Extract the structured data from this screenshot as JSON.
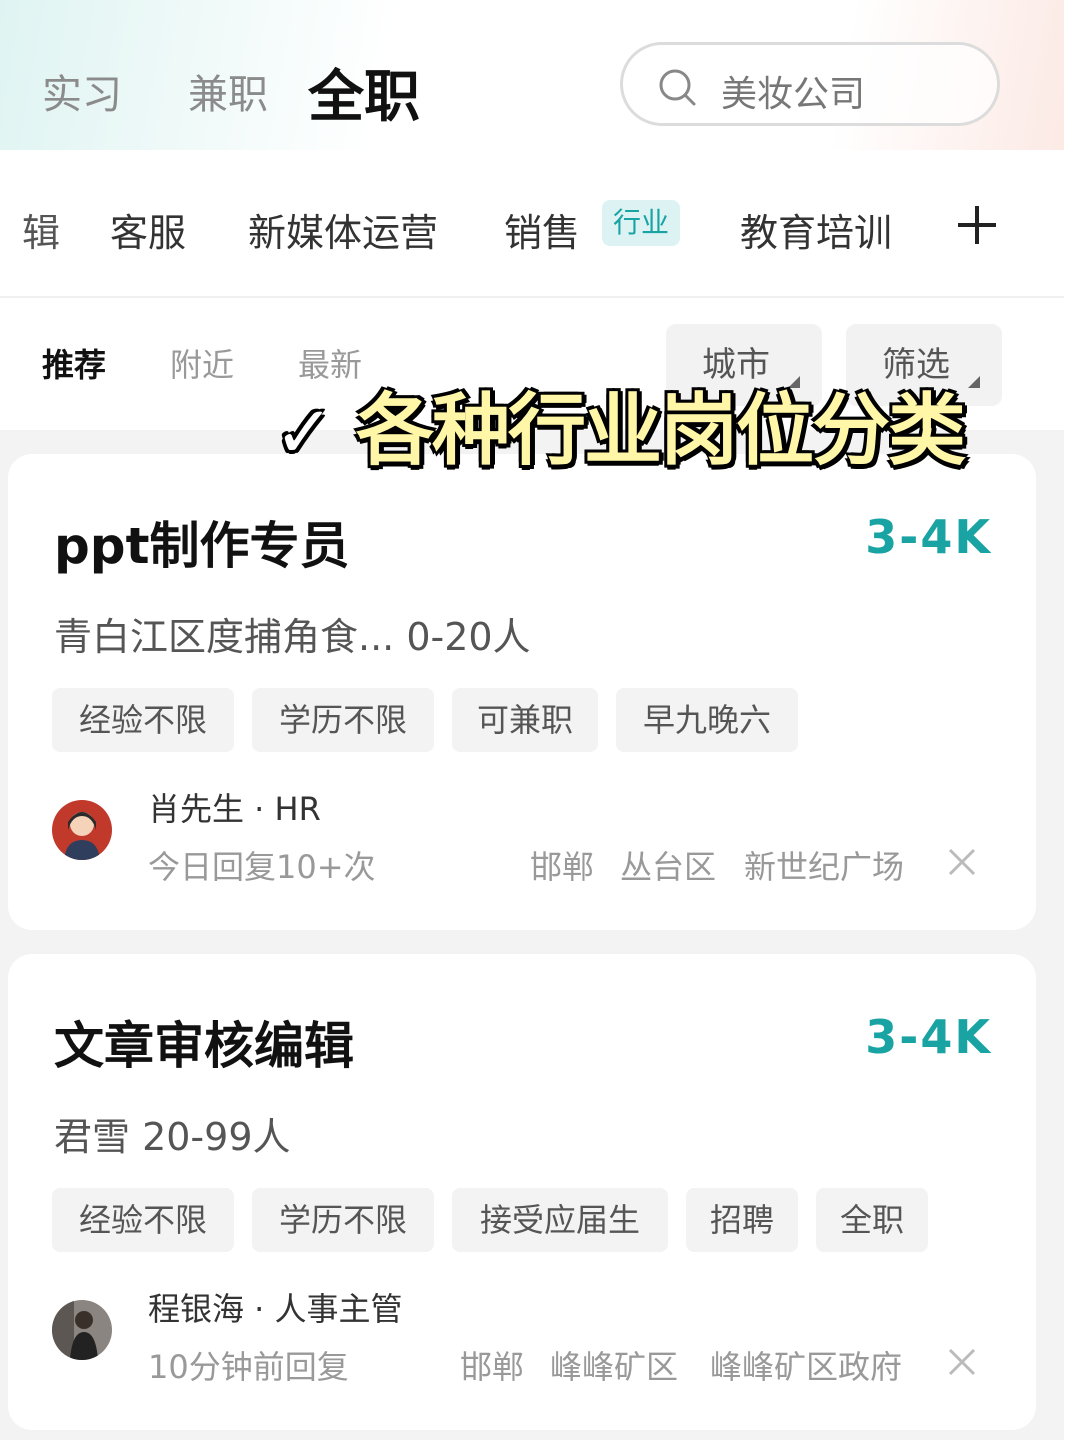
{
  "header": {
    "tabs": [
      "实习",
      "兼职",
      "全职"
    ],
    "active_tab": "全职",
    "search_placeholder": "美妆公司"
  },
  "categories": {
    "partial_left": "辑",
    "items": [
      "客服",
      "新媒体运营",
      "销售",
      "教育培训"
    ],
    "badge": "行业"
  },
  "sort": {
    "options": [
      "推荐",
      "附近",
      "最新"
    ],
    "filters": [
      "城市",
      "筛选"
    ]
  },
  "overlay": {
    "check": "✓",
    "text": "各种行业岗位分类"
  },
  "jobs": [
    {
      "title": "ppt制作专员",
      "salary": "3-4K",
      "company": "青白江区度捕角食... 0-20人",
      "tags": [
        "经验不限",
        "学历不限",
        "可兼职",
        "早九晚六"
      ],
      "hr": "肖先生 · HR",
      "reply": "今日回复10+次",
      "location": [
        "邯郸",
        "丛台区",
        "新世纪广场"
      ]
    },
    {
      "title": "文章审核编辑",
      "salary": "3-4K",
      "company": "君雪  20-99人",
      "tags": [
        "经验不限",
        "学历不限",
        "接受应届生",
        "招聘",
        "全职"
      ],
      "hr": "程银海 · 人事主管",
      "reply": "10分钟前回复",
      "location": [
        "邯郸",
        "峰峰矿区",
        "峰峰矿区政府"
      ]
    }
  ],
  "colors": {
    "accent": "#1aa3a3",
    "badge_bg": "#ddf3f3",
    "overlay_text": "#fff6a8"
  }
}
